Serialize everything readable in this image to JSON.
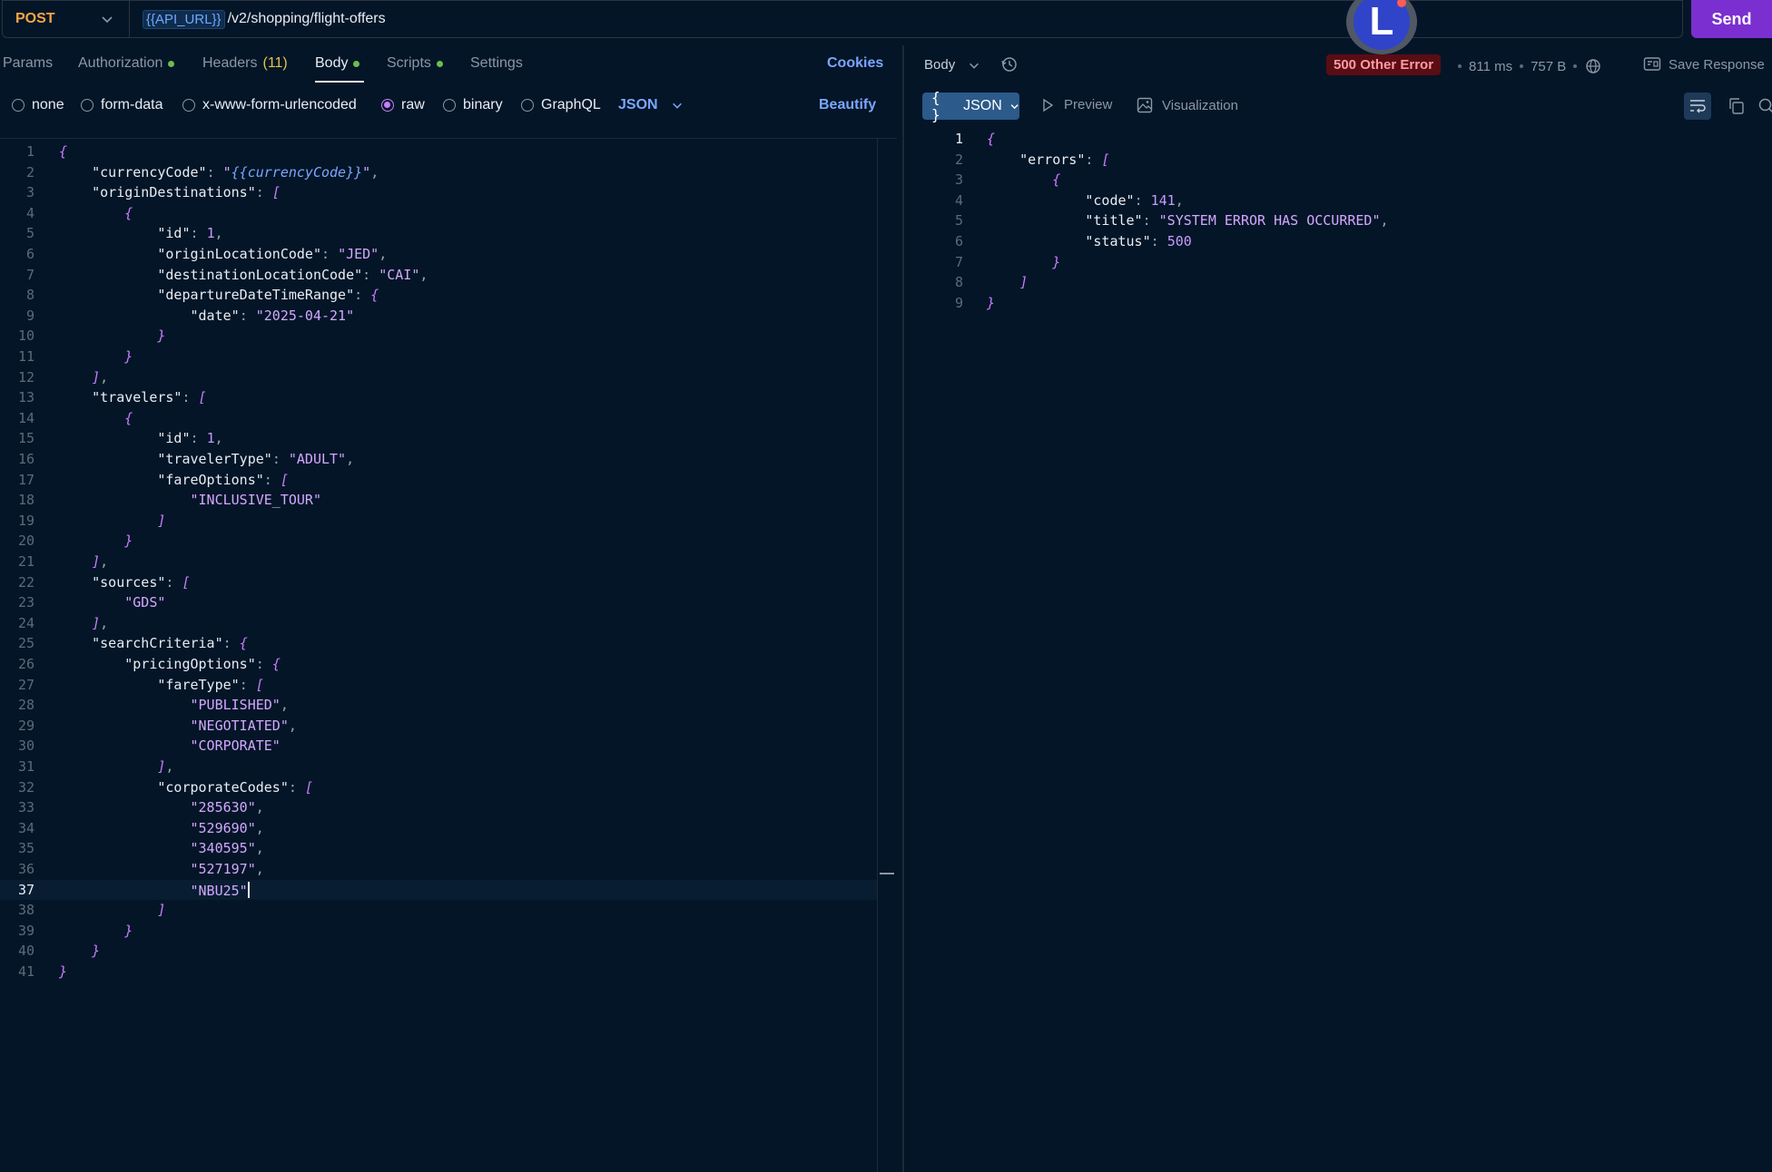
{
  "request": {
    "method": "POST",
    "url_variable": "{{API_URL}}",
    "url_path": "/v2/shopping/flight-offers",
    "send_label": "Send"
  },
  "avatar": {
    "initial": "L"
  },
  "tabs": {
    "params": "Params",
    "authorization": "Authorization",
    "headers": "Headers",
    "headers_count": "(11)",
    "body": "Body",
    "scripts": "Scripts",
    "settings": "Settings",
    "cookies": "Cookies"
  },
  "body_types": {
    "none": "none",
    "form_data": "form-data",
    "urlencoded": "x-www-form-urlencoded",
    "raw": "raw",
    "binary": "binary",
    "graphql": "GraphQL",
    "selected": "raw",
    "language": "JSON",
    "beautify": "Beautify"
  },
  "editor": {
    "current_line": 37,
    "lines": [
      "{",
      "    \"currencyCode\": \"{{currencyCode}}\",",
      "    \"originDestinations\": [",
      "        {",
      "            \"id\": 1,",
      "            \"originLocationCode\": \"JED\",",
      "            \"destinationLocationCode\": \"CAI\",",
      "            \"departureDateTimeRange\": {",
      "                \"date\": \"2025-04-21\"",
      "            }",
      "        }",
      "    ],",
      "    \"travelers\": [",
      "        {",
      "            \"id\": 1,",
      "            \"travelerType\": \"ADULT\",",
      "            \"fareOptions\": [",
      "                \"INCLUSIVE_TOUR\"",
      "            ]",
      "        }",
      "    ],",
      "    \"sources\": [",
      "        \"GDS\"",
      "    ],",
      "    \"searchCriteria\": {",
      "        \"pricingOptions\": {",
      "            \"fareType\": [",
      "                \"PUBLISHED\",",
      "                \"NEGOTIATED\",",
      "                \"CORPORATE\"",
      "            ],",
      "            \"corporateCodes\": [",
      "                \"285630\",",
      "                \"529690\",",
      "                \"340595\",",
      "                \"527197\",",
      "                \"NBU25\"",
      "            ]",
      "        }",
      "    }",
      "}"
    ]
  },
  "response": {
    "body_label": "Body",
    "status": "500 Other Error",
    "time": "811 ms",
    "size": "757 B",
    "save_label": "Save Response",
    "format": "JSON",
    "preview": "Preview",
    "visualization": "Visualization",
    "lines": [
      "{",
      "    \"errors\": [",
      "        {",
      "            \"code\": 141,",
      "            \"title\": \"SYSTEM ERROR HAS OCCURRED\",",
      "            \"status\": 500",
      "        }",
      "    ]",
      "}"
    ]
  },
  "colors": {
    "background": "#041527",
    "accent": "#7b2fd0",
    "link": "#7aa6ff",
    "method": "#f5a742",
    "error_badge": "#5a0d14"
  }
}
